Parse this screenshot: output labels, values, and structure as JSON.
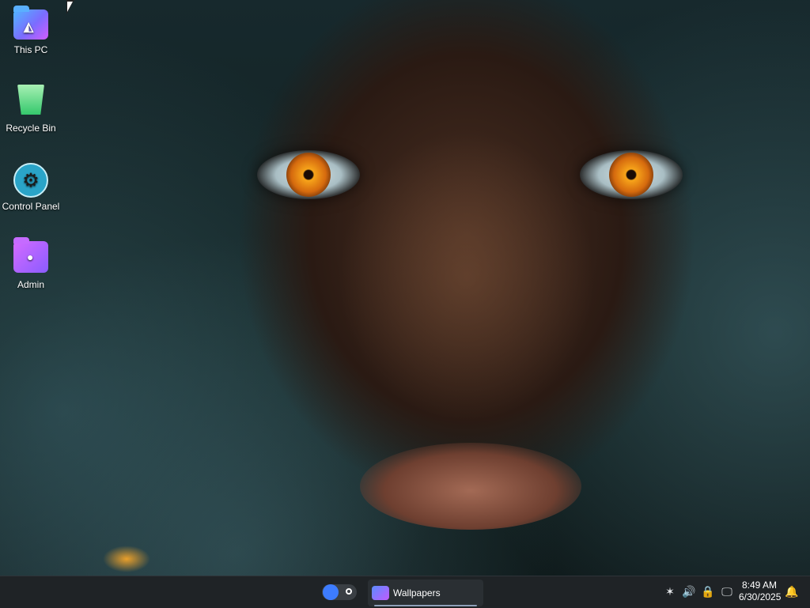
{
  "desktop": {
    "icons": [
      {
        "label": "This PC",
        "icon": "folder-icon"
      },
      {
        "label": "Recycle Bin",
        "icon": "recycle-bin-icon"
      },
      {
        "label": "Control Panel",
        "icon": "gear-icon"
      },
      {
        "label": "Admin",
        "icon": "user-folder-icon"
      }
    ]
  },
  "taskbar": {
    "apps": [
      {
        "label": "Wallpapers",
        "icon": "folder-icon",
        "active": true
      }
    ],
    "tray": {
      "icons": [
        "brightness-icon",
        "volume-icon",
        "security-icon",
        "network-icon",
        "notification-bell-icon"
      ]
    },
    "clock": {
      "time": "8:49 AM",
      "date": "6/30/2025"
    }
  },
  "colors": {
    "taskbar_bg": "#1f2326",
    "toggle_accent": "#3d7cff",
    "folder_gradient_start": "#4fb7ff",
    "folder_gradient_end": "#d15cff"
  }
}
